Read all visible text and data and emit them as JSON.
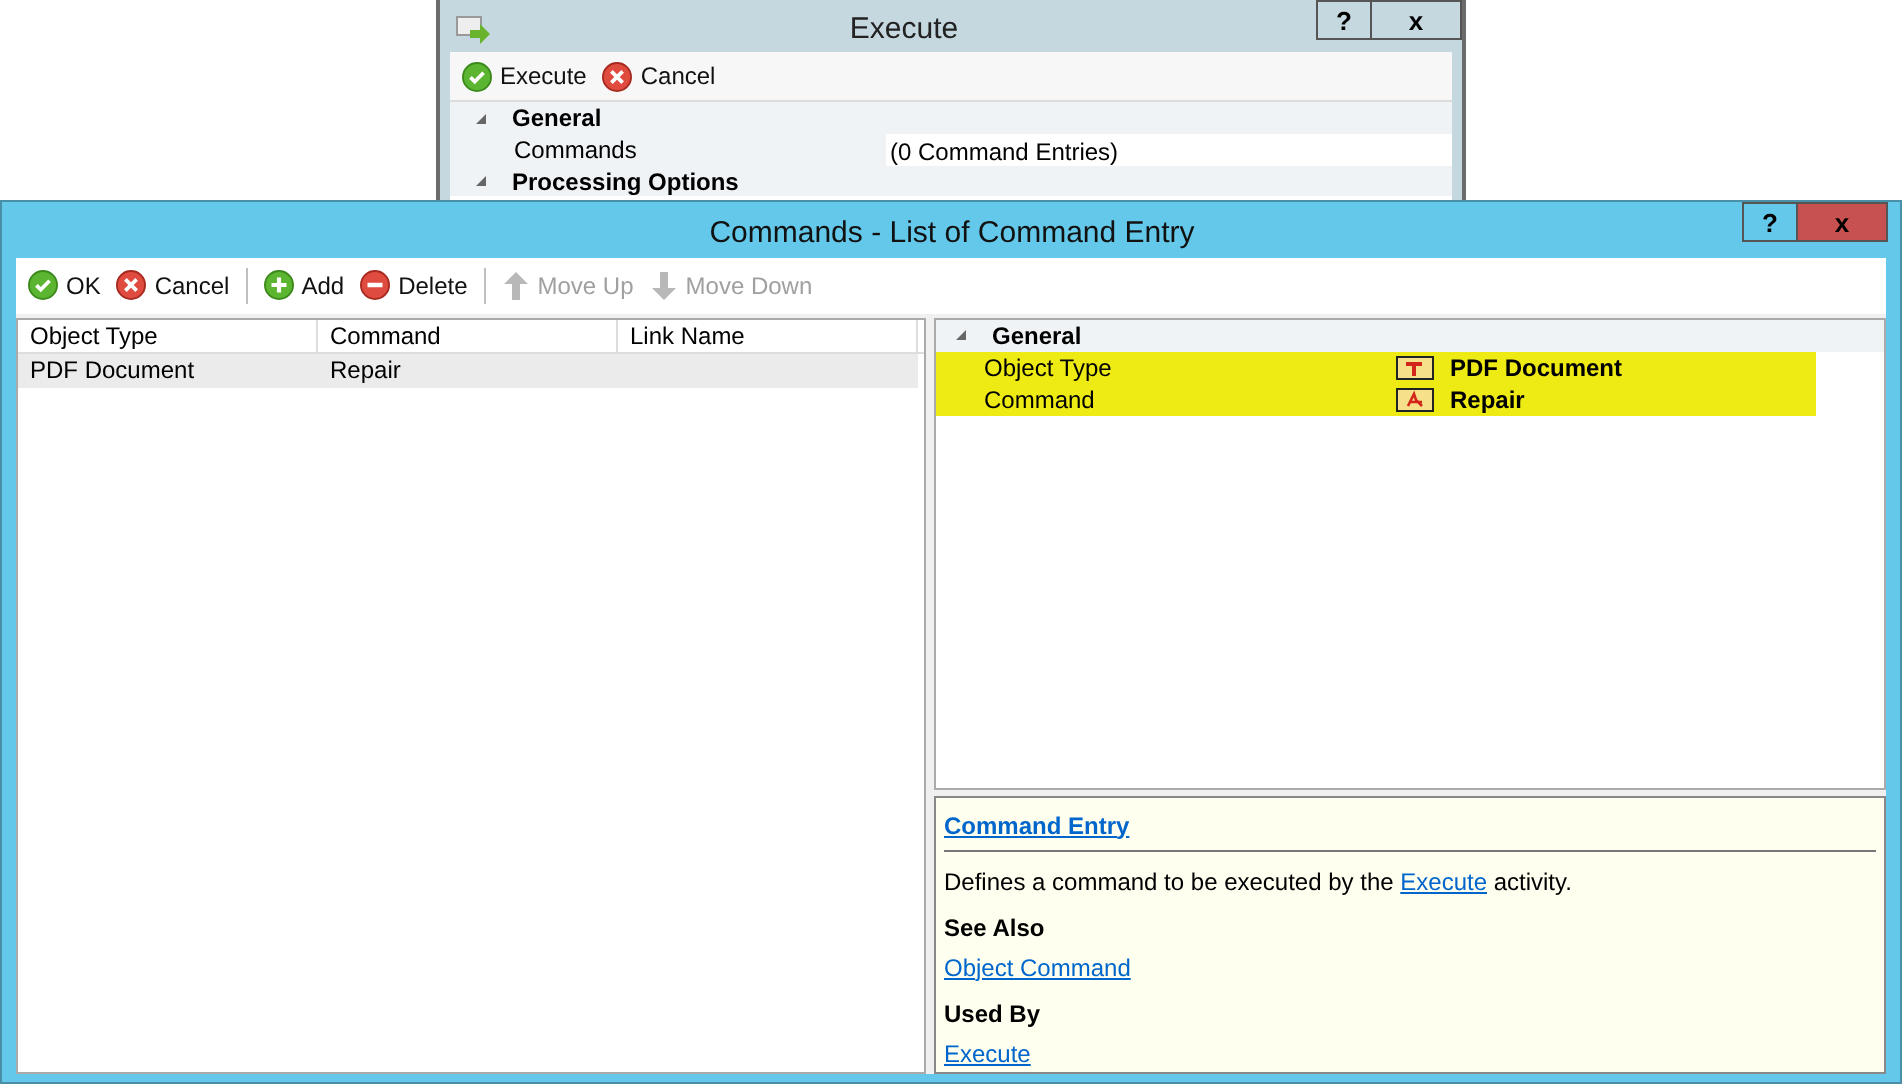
{
  "back_window": {
    "title": "Execute",
    "help_button": "?",
    "close_button": "x",
    "toolbar": [
      {
        "label": "Execute",
        "kind": "check",
        "disabled": false
      },
      {
        "label": "Cancel",
        "kind": "cancel",
        "disabled": false
      }
    ],
    "properties": {
      "category": "General",
      "rows": [
        {
          "name": "Commands",
          "value": "(0 Command Entries)"
        }
      ],
      "next_category": "Processing Options"
    }
  },
  "window": {
    "title": "Commands - List of Command Entry",
    "help_button": "?",
    "close_button": "x",
    "toolbar": [
      {
        "label": "OK",
        "kind": "check",
        "disabled": false
      },
      {
        "label": "Cancel",
        "kind": "cancel",
        "disabled": false
      },
      {
        "label": "Add",
        "kind": "add",
        "disabled": false,
        "separator_before": true
      },
      {
        "label": "Delete",
        "kind": "delete",
        "disabled": false
      },
      {
        "label": "Move Up",
        "kind": "up",
        "disabled": true,
        "separator_before": true
      },
      {
        "label": "Move Down",
        "kind": "down",
        "disabled": true
      }
    ],
    "table": {
      "columns": [
        "Object Type",
        "Command",
        "Link Name"
      ],
      "rows": [
        {
          "cells": [
            "PDF Document",
            "Repair",
            ""
          ],
          "selected": true
        }
      ]
    },
    "properties": {
      "category": "General",
      "rows": [
        {
          "name": "Object Type",
          "value": "PDF Document",
          "highlighted": true
        },
        {
          "name": "Command",
          "value": "Repair",
          "highlighted": true
        }
      ]
    },
    "help": {
      "title": "Command Entry",
      "description": {
        "before": "Defines a command to be executed by the ",
        "link": "Execute",
        "after": " activity."
      },
      "sections": [
        {
          "heading": "See Also",
          "links": [
            "Object Command"
          ]
        },
        {
          "heading": "Used By",
          "links": [
            "Execute"
          ]
        }
      ]
    }
  }
}
